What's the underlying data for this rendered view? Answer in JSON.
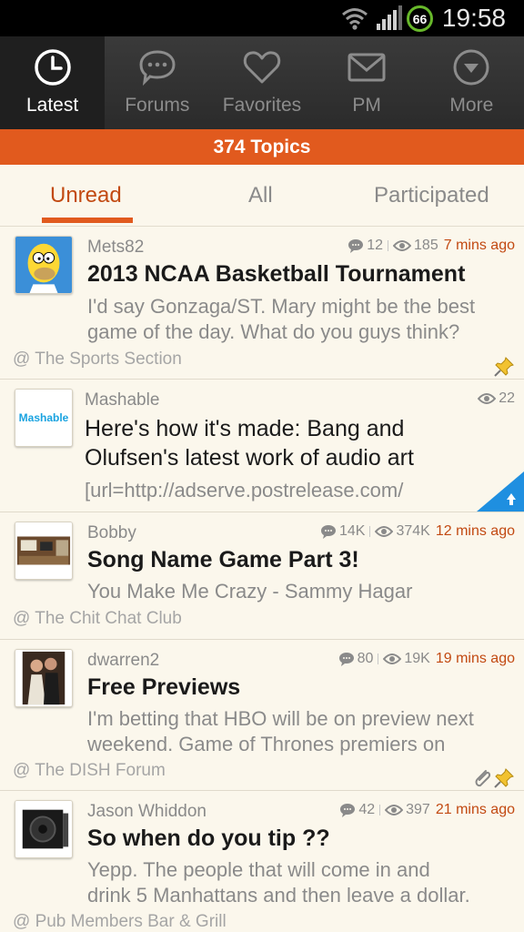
{
  "status": {
    "time": "19:58",
    "battery": "66"
  },
  "tabs": [
    {
      "label": "Latest",
      "icon": "clock-icon"
    },
    {
      "label": "Forums",
      "icon": "chat-bubble-icon"
    },
    {
      "label": "Favorites",
      "icon": "heart-icon"
    },
    {
      "label": "PM",
      "icon": "envelope-icon"
    },
    {
      "label": "More",
      "icon": "chevron-circle-icon"
    }
  ],
  "banner": "374 Topics",
  "subtabs": [
    "Unread",
    "All",
    "Participated"
  ],
  "topics": [
    {
      "author": "Mets82",
      "replies": "12",
      "views": "185",
      "time": "7 mins ago",
      "title": "2013 NCAA Basketball Tournament",
      "excerpt": [
        "I'd say Gonzaga/ST. Mary might be the best",
        "game of the day. What do you guys think?"
      ],
      "forum": "@ The Sports Section"
    },
    {
      "author": "Mashable",
      "views": "22",
      "avatar_text": "Mashable",
      "title": [
        "Here's how it's made: Bang and",
        "Olufsen's latest work of audio art"
      ],
      "excerpt": [
        "[url=http://adserve.postrelease.com/"
      ]
    },
    {
      "author": "Bobby",
      "replies": "14K",
      "views": "374K",
      "time": "12 mins ago",
      "title": "Song Name Game Part 3!",
      "excerpt": [
        "You Make Me Crazy - Sammy Hagar"
      ],
      "forum": "@ The Chit Chat Club"
    },
    {
      "author": "dwarren2",
      "replies": "80",
      "views": "19K",
      "time": "19 mins ago",
      "title": "Free Previews",
      "excerpt": [
        "I'm betting that HBO will be on preview next",
        "weekend. Game of Thrones premiers on"
      ],
      "forum": "@ The DISH Forum"
    },
    {
      "author": "Jason Whiddon",
      "replies": "42",
      "views": "397",
      "time": "21 mins ago",
      "title": "So when do you tip ??",
      "excerpt": [
        "Yepp. The people that will come in and",
        "drink 5 Manhattans and then leave a dollar."
      ],
      "forum": "@ Pub Members Bar & Grill"
    }
  ],
  "colors": {
    "accent": "#e15a1e",
    "time": "#c24a12",
    "promo": "#1f8fe0"
  }
}
